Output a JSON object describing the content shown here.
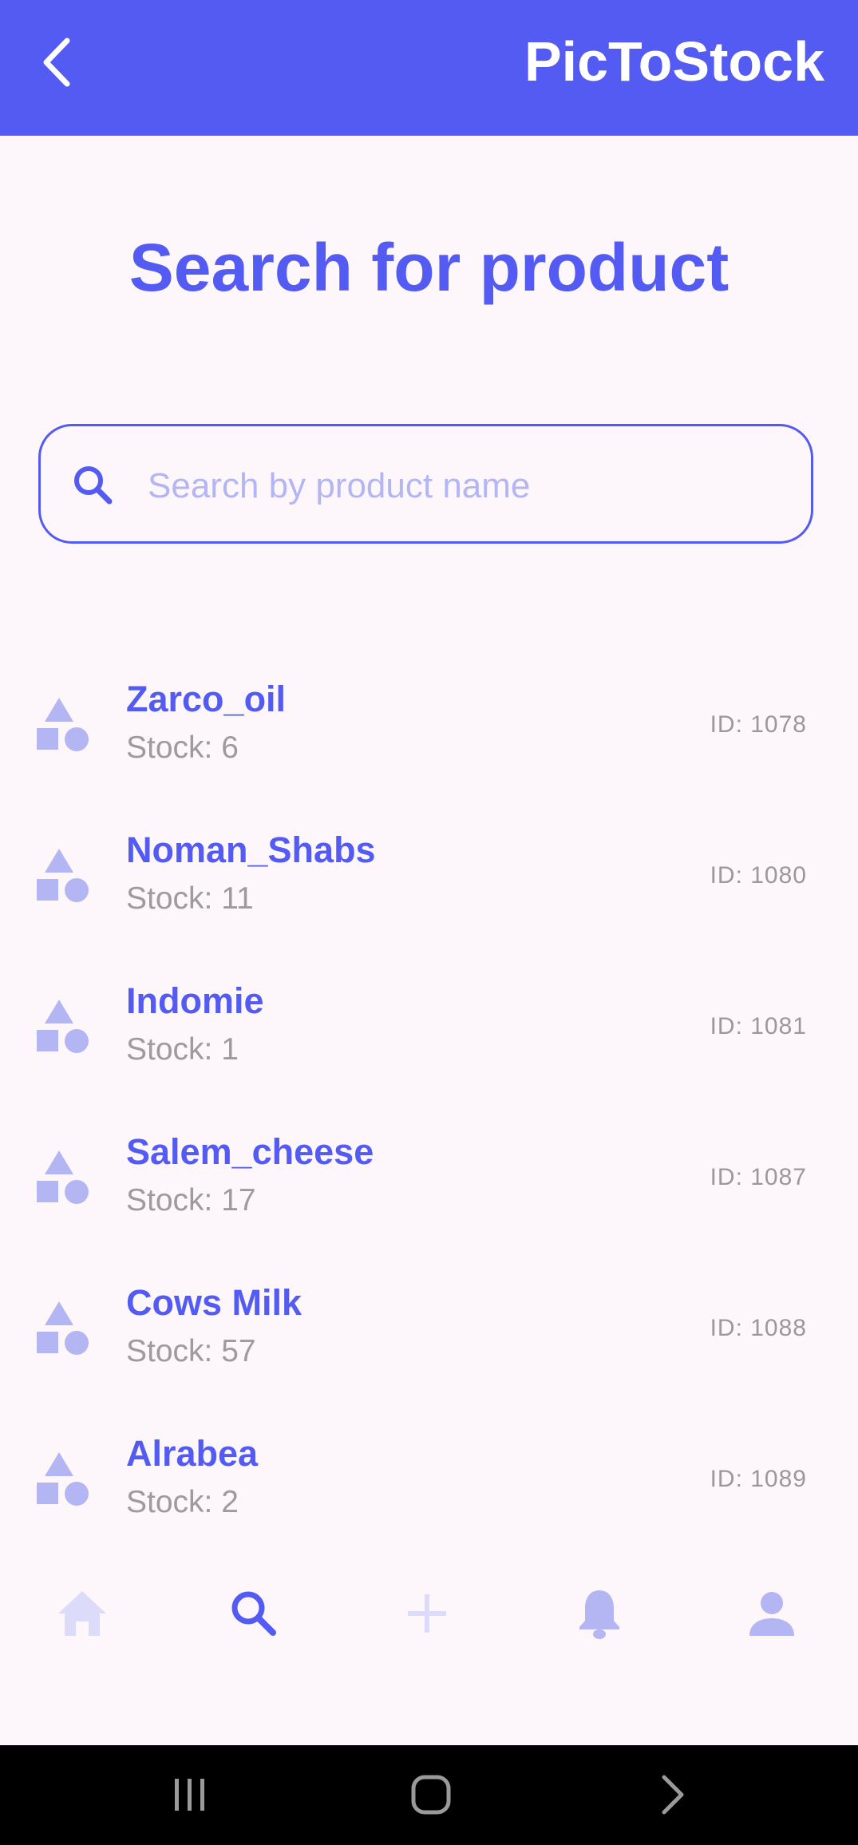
{
  "header": {
    "app_title": "PicToStock",
    "back_icon": "back-arrow-icon"
  },
  "page": {
    "title": "Search for product"
  },
  "search": {
    "placeholder": "Search by product name",
    "value": "",
    "icon": "search-icon"
  },
  "products": [
    {
      "name": "Zarco_oil",
      "stock": "Stock: 6",
      "id": "ID: 1078"
    },
    {
      "name": "Noman_Shabs",
      "stock": "Stock: 11",
      "id": "ID: 1080"
    },
    {
      "name": "Indomie",
      "stock": "Stock: 1",
      "id": "ID: 1081"
    },
    {
      "name": "Salem_cheese",
      "stock": "Stock: 17",
      "id": "ID: 1087"
    },
    {
      "name": "Cows Milk",
      "stock": "Stock: 57",
      "id": "ID: 1088"
    },
    {
      "name": "Alrabea",
      "stock": "Stock: 2",
      "id": "ID: 1089"
    }
  ],
  "bottom_nav": {
    "items": [
      {
        "icon": "home-icon",
        "active": false
      },
      {
        "icon": "search-icon",
        "active": true
      },
      {
        "icon": "add-icon",
        "active": false
      },
      {
        "icon": "bell-icon",
        "active": false
      },
      {
        "icon": "person-icon",
        "active": false
      }
    ]
  },
  "system_nav": {
    "items": [
      "recents-icon",
      "home-icon",
      "back-icon"
    ]
  },
  "colors": {
    "primary": "#535bf2",
    "background": "#fdf7fb",
    "icon_light": "#b3b6f3",
    "nav_inactive": "#dcdcfa",
    "text_muted": "#9e9a9e"
  }
}
